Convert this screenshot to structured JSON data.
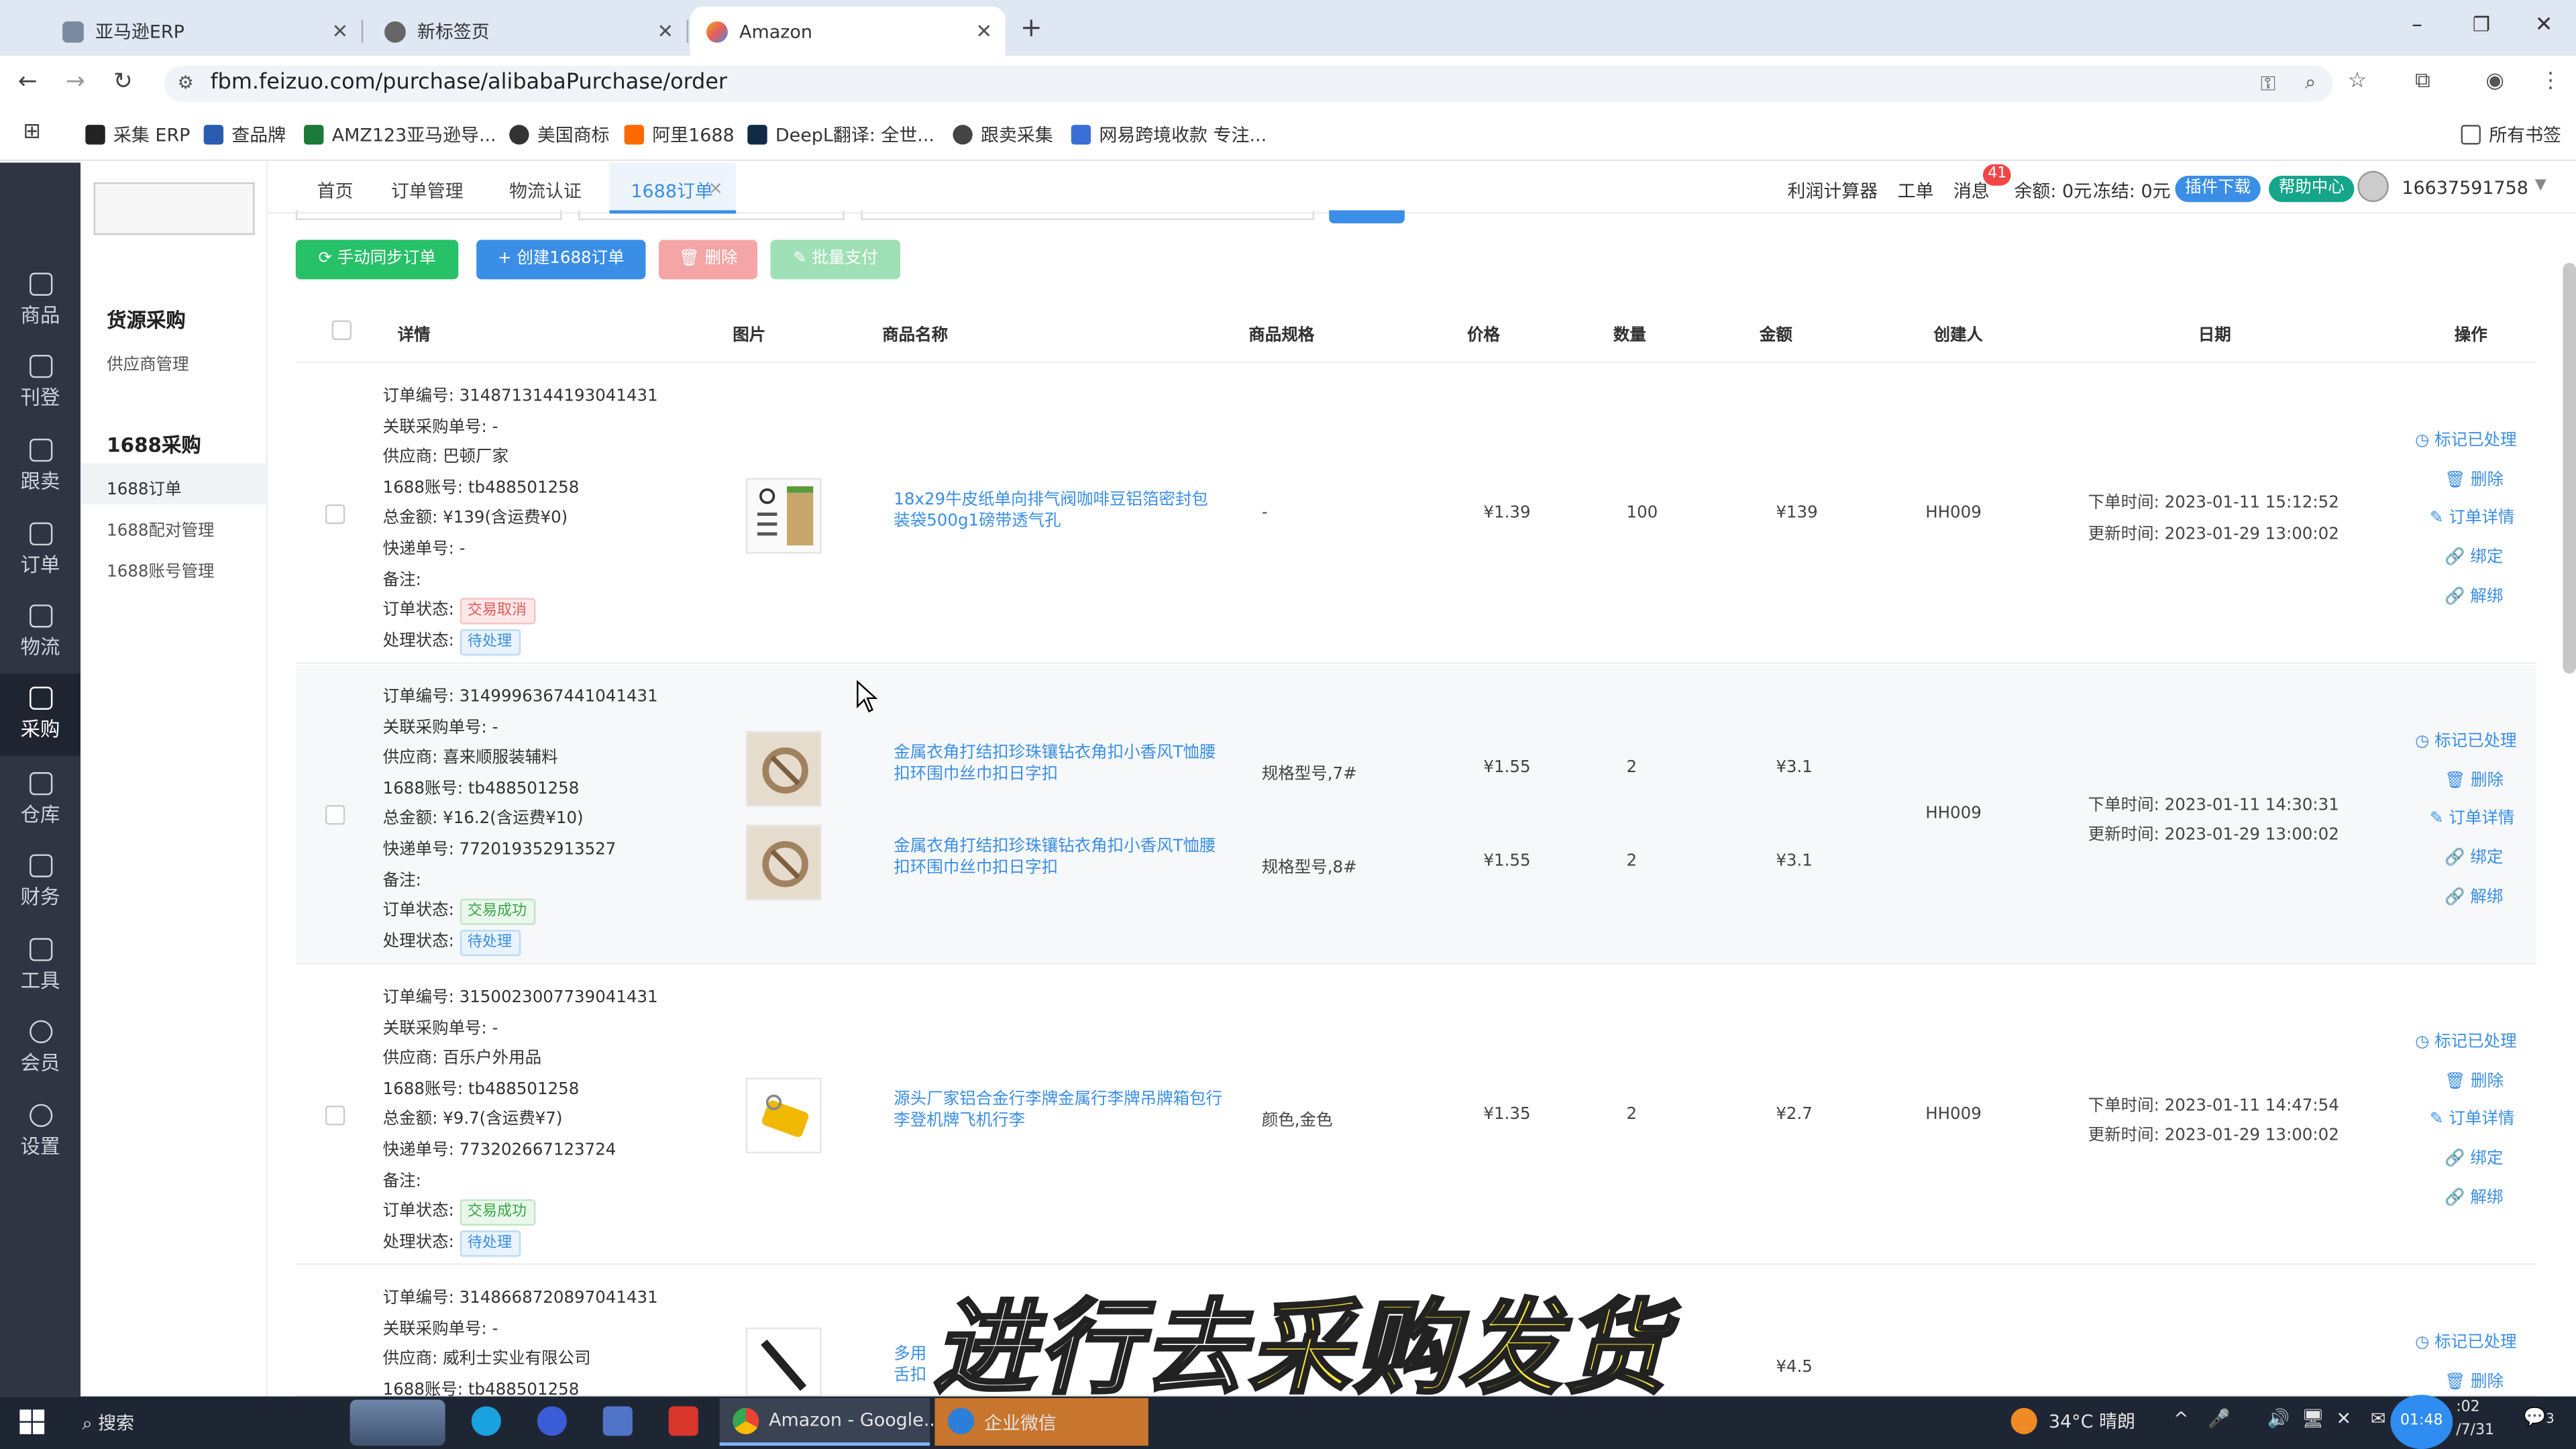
{
  "browser": {
    "tabs": [
      {
        "label": "亚马逊ERP",
        "active": false
      },
      {
        "label": "新标签页",
        "active": false
      },
      {
        "label": "Amazon",
        "active": true
      }
    ],
    "new_tab": "+",
    "url": "fbm.feizuo.com/purchase/alibabaPurchase/order",
    "window_controls": {
      "minimize": "–",
      "restore": "❐",
      "close": "✕"
    },
    "bookmarks": [
      "采集 ERP",
      "查品牌",
      "AMZ123亚马逊导...",
      "美国商标",
      "阿里1688",
      "DeepL翻译: 全世...",
      "跟卖采集",
      "网易跨境收款 专注..."
    ],
    "all_bookmarks": "所有书签"
  },
  "sidebar": {
    "items": [
      {
        "label": "商品"
      },
      {
        "label": "刊登"
      },
      {
        "label": "跟卖"
      },
      {
        "label": "订单"
      },
      {
        "label": "物流"
      },
      {
        "label": "采购"
      },
      {
        "label": "仓库"
      },
      {
        "label": "财务"
      },
      {
        "label": "工具"
      },
      {
        "label": "会员"
      },
      {
        "label": "设置"
      }
    ],
    "active": "采购"
  },
  "subnav": {
    "group1_title": "货源采购",
    "group1_items": [
      "供应商管理"
    ],
    "group2_title": "1688采购",
    "group2_items": [
      "1688订单",
      "1688配对管理",
      "1688账号管理"
    ]
  },
  "header": {
    "tabs": [
      "首页",
      "订单管理",
      "物流认证",
      "1688订单"
    ],
    "tab_close": "×",
    "calc": "利润计算器",
    "workorder": "工单",
    "messages": "消息",
    "message_badge": "41",
    "balance": "余额: 0元",
    "frozen": "冻结: 0元",
    "plugin": "插件下载",
    "help": "帮助中心",
    "user": "16637591758"
  },
  "toolbar": {
    "sync": "手动同步订单",
    "create": "创建1688订单",
    "delete": "删除",
    "pay": "批量支付"
  },
  "table": {
    "headers": [
      "详情",
      "图片",
      "商品名称",
      "商品规格",
      "价格",
      "数量",
      "金额",
      "创建人",
      "日期",
      "操作"
    ],
    "labels": {
      "order_no": "订单编号: ",
      "related": "关联采购单号: ",
      "supplier": "供应商: ",
      "account": "1688账号: ",
      "total": "总金额: ",
      "tracking": "快递单号: ",
      "note": "备注:",
      "order_status": "订单状态: ",
      "process_status": "处理状态: ",
      "order_time": "下单时间: ",
      "update_time": "更新时间: "
    },
    "actions": [
      "标记已处理",
      "删除",
      "订单详情",
      "绑定",
      "解绑"
    ],
    "rows": [
      {
        "order_no": "3148713144193041431",
        "related": "-",
        "supplier": "巴顿厂家",
        "account": "tb488501258",
        "total": "¥139(含运费¥0)",
        "tracking": "-",
        "order_status": "交易取消",
        "process_status": "待处理",
        "creator": "HH009",
        "order_time": "2023-01-11 15:12:52",
        "update_time": "2023-01-29 13:00:02",
        "items": [
          {
            "name": "18x29牛皮纸单向排气阀咖啡豆铝箔密封包装袋500g1磅带透气孔",
            "spec": "-",
            "price": "¥1.39",
            "qty": "100",
            "amount": "¥139"
          }
        ]
      },
      {
        "order_no": "3149996367441041431",
        "related": "-",
        "supplier": "喜来顺服装辅料",
        "account": "tb488501258",
        "total": "¥16.2(含运费¥10)",
        "tracking": "772019352913527",
        "order_status": "交易成功",
        "process_status": "待处理",
        "creator": "HH009",
        "order_time": "2023-01-11 14:30:31",
        "update_time": "2023-01-29 13:00:02",
        "items": [
          {
            "name": "金属衣角打结扣珍珠镶钻衣角扣小香风T恤腰扣环围巾丝巾扣日字扣",
            "spec": "规格型号,7#",
            "price": "¥1.55",
            "qty": "2",
            "amount": "¥3.1"
          },
          {
            "name": "金属衣角打结扣珍珠镶钻衣角扣小香风T恤腰扣环围巾丝巾扣日字扣",
            "spec": "规格型号,8#",
            "price": "¥1.55",
            "qty": "2",
            "amount": "¥3.1"
          }
        ]
      },
      {
        "order_no": "3150023007739041431",
        "related": "-",
        "supplier": "百乐户外用品",
        "account": "tb488501258",
        "total": "¥9.7(含运费¥7)",
        "tracking": "773202667123724",
        "order_status": "交易成功",
        "process_status": "待处理",
        "creator": "HH009",
        "order_time": "2023-01-11 14:47:54",
        "update_time": "2023-01-29 13:00:02",
        "items": [
          {
            "name": "源头厂家铝合金行李牌金属行李牌吊牌箱包行李登机牌飞机行李",
            "spec": "颜色,金色",
            "price": "¥1.35",
            "qty": "2",
            "amount": "¥2.7"
          }
        ]
      },
      {
        "order_no": "3148668720897041431",
        "related": "-",
        "supplier": "威利士实业有限公司",
        "account": "tb488501258",
        "name_partial": "多用",
        "name_partial2": "舌扣",
        "amount": "¥4.5"
      }
    ]
  },
  "overlay": {
    "part1": "进行去",
    "part2": "采购发货"
  },
  "taskbar": {
    "search": "搜索",
    "apps": [
      "Amazon - Google...",
      "企业微信"
    ],
    "weather": "34°C 晴朗",
    "time": "01:48",
    "clock_partial": ":02",
    "date": "/7/31",
    "notifications": "3"
  },
  "colors": {
    "primary": "#3a8ee6",
    "success": "#27c168",
    "danger": "#f07b7b",
    "sidebar": "#2f3542"
  }
}
